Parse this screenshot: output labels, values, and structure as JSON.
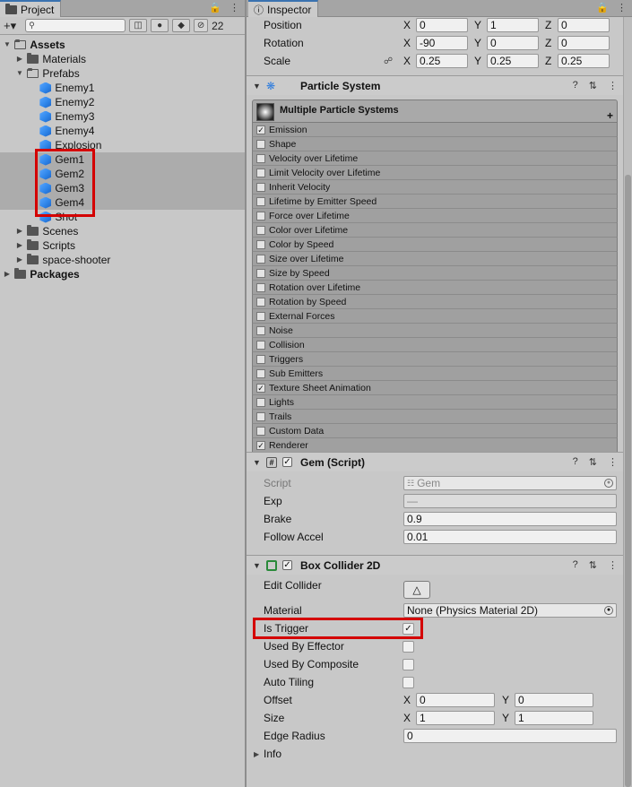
{
  "project": {
    "tab_label": "Project",
    "hidden_count": "22",
    "search_placeholder": "",
    "tree": [
      {
        "label": "Assets",
        "depth": 0,
        "type": "folder-open",
        "arrow": "down",
        "bold": true
      },
      {
        "label": "Materials",
        "depth": 1,
        "type": "folder",
        "arrow": "right"
      },
      {
        "label": "Prefabs",
        "depth": 1,
        "type": "folder-open",
        "arrow": "down"
      },
      {
        "label": "Enemy1",
        "depth": 2,
        "type": "prefab"
      },
      {
        "label": "Enemy2",
        "depth": 2,
        "type": "prefab"
      },
      {
        "label": "Enemy3",
        "depth": 2,
        "type": "prefab"
      },
      {
        "label": "Enemy4",
        "depth": 2,
        "type": "prefab"
      },
      {
        "label": "Explosion",
        "depth": 2,
        "type": "prefab"
      },
      {
        "label": "Gem1",
        "depth": 2,
        "type": "prefab",
        "selected": true
      },
      {
        "label": "Gem2",
        "depth": 2,
        "type": "prefab",
        "selected": true
      },
      {
        "label": "Gem3",
        "depth": 2,
        "type": "prefab",
        "selected": true
      },
      {
        "label": "Gem4",
        "depth": 2,
        "type": "prefab",
        "selected": true
      },
      {
        "label": "Shot",
        "depth": 2,
        "type": "prefab"
      },
      {
        "label": "Scenes",
        "depth": 1,
        "type": "folder",
        "arrow": "right"
      },
      {
        "label": "Scripts",
        "depth": 1,
        "type": "folder",
        "arrow": "right"
      },
      {
        "label": "space-shooter",
        "depth": 1,
        "type": "folder",
        "arrow": "right"
      },
      {
        "label": "Packages",
        "depth": 0,
        "type": "folder",
        "arrow": "right",
        "bold": true
      }
    ]
  },
  "inspector": {
    "tab_label": "Inspector",
    "transform": {
      "position": {
        "label": "Position",
        "x": "0",
        "y": "1",
        "z": "0"
      },
      "rotation": {
        "label": "Rotation",
        "x": "-90",
        "y": "0",
        "z": "0"
      },
      "scale": {
        "label": "Scale",
        "x": "0.25",
        "y": "0.25",
        "z": "0.25"
      }
    },
    "particle_system": {
      "title": "Particle System",
      "header": "Multiple Particle Systems",
      "modules": [
        {
          "label": "Emission",
          "checked": true
        },
        {
          "label": "Shape",
          "checked": false
        },
        {
          "label": "Velocity over Lifetime",
          "checked": false
        },
        {
          "label": "Limit Velocity over Lifetime",
          "checked": false
        },
        {
          "label": "Inherit Velocity",
          "checked": false
        },
        {
          "label": "Lifetime by Emitter Speed",
          "checked": false
        },
        {
          "label": "Force over Lifetime",
          "checked": false
        },
        {
          "label": "Color over Lifetime",
          "checked": false
        },
        {
          "label": "Color by Speed",
          "checked": false
        },
        {
          "label": "Size over Lifetime",
          "checked": false
        },
        {
          "label": "Size by Speed",
          "checked": false
        },
        {
          "label": "Rotation over Lifetime",
          "checked": false
        },
        {
          "label": "Rotation by Speed",
          "checked": false
        },
        {
          "label": "External Forces",
          "checked": false
        },
        {
          "label": "Noise",
          "checked": false
        },
        {
          "label": "Collision",
          "checked": false
        },
        {
          "label": "Triggers",
          "checked": false
        },
        {
          "label": "Sub Emitters",
          "checked": false
        },
        {
          "label": "Texture Sheet Animation",
          "checked": true
        },
        {
          "label": "Lights",
          "checked": false
        },
        {
          "label": "Trails",
          "checked": false
        },
        {
          "label": "Custom Data",
          "checked": false
        },
        {
          "label": "Renderer",
          "checked": true
        }
      ]
    },
    "gem_script": {
      "title": "Gem (Script)",
      "script_label": "Script",
      "script_value": "Gem",
      "exp_label": "Exp",
      "exp_value": "—",
      "brake_label": "Brake",
      "brake_value": "0.9",
      "follow_label": "Follow Accel",
      "follow_value": "0.01"
    },
    "box_collider": {
      "title": "Box Collider 2D",
      "edit_label": "Edit Collider",
      "material_label": "Material",
      "material_value": "None (Physics Material 2D)",
      "is_trigger_label": "Is Trigger",
      "is_trigger": true,
      "used_by_effector_label": "Used By Effector",
      "used_by_composite_label": "Used By Composite",
      "auto_tiling_label": "Auto Tiling",
      "offset_label": "Offset",
      "offset_x": "0",
      "offset_y": "0",
      "size_label": "Size",
      "size_x": "1",
      "size_y": "1",
      "edge_radius_label": "Edge Radius",
      "edge_radius_value": "0",
      "info_label": "Info"
    }
  }
}
